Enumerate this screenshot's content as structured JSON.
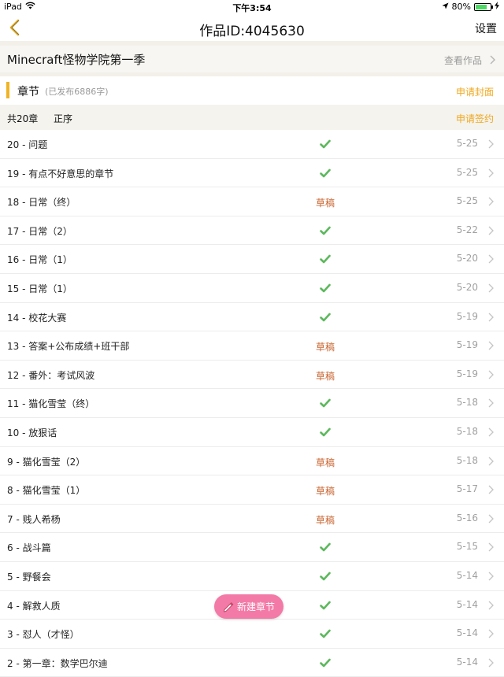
{
  "status_bar": {
    "device": "iPad",
    "time": "下午3:54",
    "battery": "80%",
    "battery_level": 0.8
  },
  "nav": {
    "title": "作品ID:4045630",
    "settings_label": "设置",
    "back_icon": "chevron-left-icon"
  },
  "work": {
    "title": "Minecraft怪物学院第一季",
    "view_label": "查看作品"
  },
  "section": {
    "label": "章节",
    "published_info": "(已发布6886字)",
    "apply_cover_label": "申请封面"
  },
  "list_header": {
    "total": "共20章",
    "order": "正序",
    "apply_sign_label": "申请签约"
  },
  "colors": {
    "accent": "#f0b323",
    "link": "#f0a81e",
    "draft": "#c8642f",
    "check": "#5cb85c",
    "new_button": "#f37aa6"
  },
  "chapters": [
    {
      "name": "20 - 问题",
      "status": "published",
      "draft_label": "",
      "date": "5-25"
    },
    {
      "name": "19 - 有点不好意思的章节",
      "status": "published",
      "draft_label": "",
      "date": "5-25"
    },
    {
      "name": "18 - 日常（终）",
      "status": "draft",
      "draft_label": "草稿",
      "date": "5-25"
    },
    {
      "name": "17 - 日常（2）",
      "status": "published",
      "draft_label": "",
      "date": "5-22"
    },
    {
      "name": "16 - 日常（1）",
      "status": "published",
      "draft_label": "",
      "date": "5-20"
    },
    {
      "name": "15 - 日常（1）",
      "status": "published",
      "draft_label": "",
      "date": "5-20"
    },
    {
      "name": "14 - 校花大赛",
      "status": "published",
      "draft_label": "",
      "date": "5-19"
    },
    {
      "name": "13 - 答案+公布成绩+班干部",
      "status": "draft",
      "draft_label": "草稿",
      "date": "5-19"
    },
    {
      "name": "12 - 番外：考试风波",
      "status": "draft",
      "draft_label": "草稿",
      "date": "5-19"
    },
    {
      "name": "11 - 猫化雪莹（终）",
      "status": "published",
      "draft_label": "",
      "date": "5-18"
    },
    {
      "name": "10 - 放狠话",
      "status": "published",
      "draft_label": "",
      "date": "5-18"
    },
    {
      "name": "9 - 猫化雪莹（2）",
      "status": "draft",
      "draft_label": "草稿",
      "date": "5-18"
    },
    {
      "name": "8 - 猫化雪莹（1）",
      "status": "draft",
      "draft_label": "草稿",
      "date": "5-17"
    },
    {
      "name": "7 - 贱人希杨",
      "status": "draft",
      "draft_label": "草稿",
      "date": "5-16"
    },
    {
      "name": "6 - 战斗篇",
      "status": "published",
      "draft_label": "",
      "date": "5-15"
    },
    {
      "name": "5 - 野餐会",
      "status": "published",
      "draft_label": "",
      "date": "5-14"
    },
    {
      "name": "4 - 解救人质",
      "status": "published",
      "draft_label": "",
      "date": "5-14"
    },
    {
      "name": "3 - 怼人（才怪）",
      "status": "published",
      "draft_label": "",
      "date": "5-14"
    },
    {
      "name": "2 - 第一章：数学巴尔迪",
      "status": "published",
      "draft_label": "",
      "date": "5-14"
    }
  ],
  "new_chapter_button": {
    "label": "新建章节",
    "icon": "pencil-icon"
  }
}
